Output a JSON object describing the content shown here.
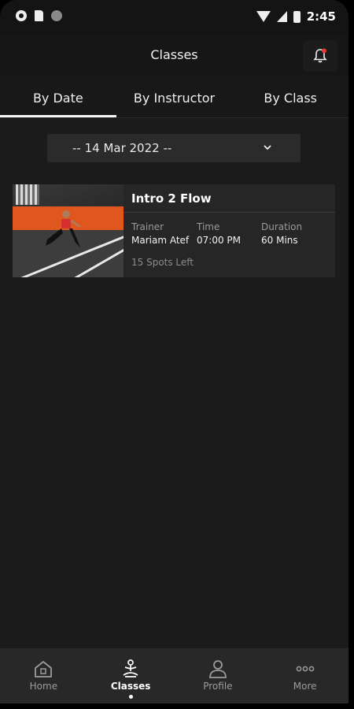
{
  "status_bar": {
    "time": "2:45"
  },
  "header": {
    "title": "Classes"
  },
  "tabs": [
    {
      "label": "By Date",
      "active": true
    },
    {
      "label": "By Instructor",
      "active": false
    },
    {
      "label": "By Class",
      "active": false
    }
  ],
  "date_filter": {
    "selected": "-- 14 Mar 2022 --"
  },
  "classes": [
    {
      "title": "Intro 2 Flow",
      "trainer_label": "Trainer",
      "trainer": "Mariam Atef",
      "time_label": "Time",
      "time": "07:00 PM",
      "duration_label": "Duration",
      "duration": "60 Mins",
      "spots": "15 Spots Left"
    }
  ],
  "nav": [
    {
      "label": "Home",
      "icon": "home-icon",
      "active": false
    },
    {
      "label": "Classes",
      "icon": "meditation-icon",
      "active": true
    },
    {
      "label": "Profile",
      "icon": "person-icon",
      "active": false
    },
    {
      "label": "More",
      "icon": "more-dots-icon",
      "active": false
    }
  ],
  "colors": {
    "accent_dot": "#e53935",
    "background": "#1b1b1b",
    "card": "#262626"
  }
}
